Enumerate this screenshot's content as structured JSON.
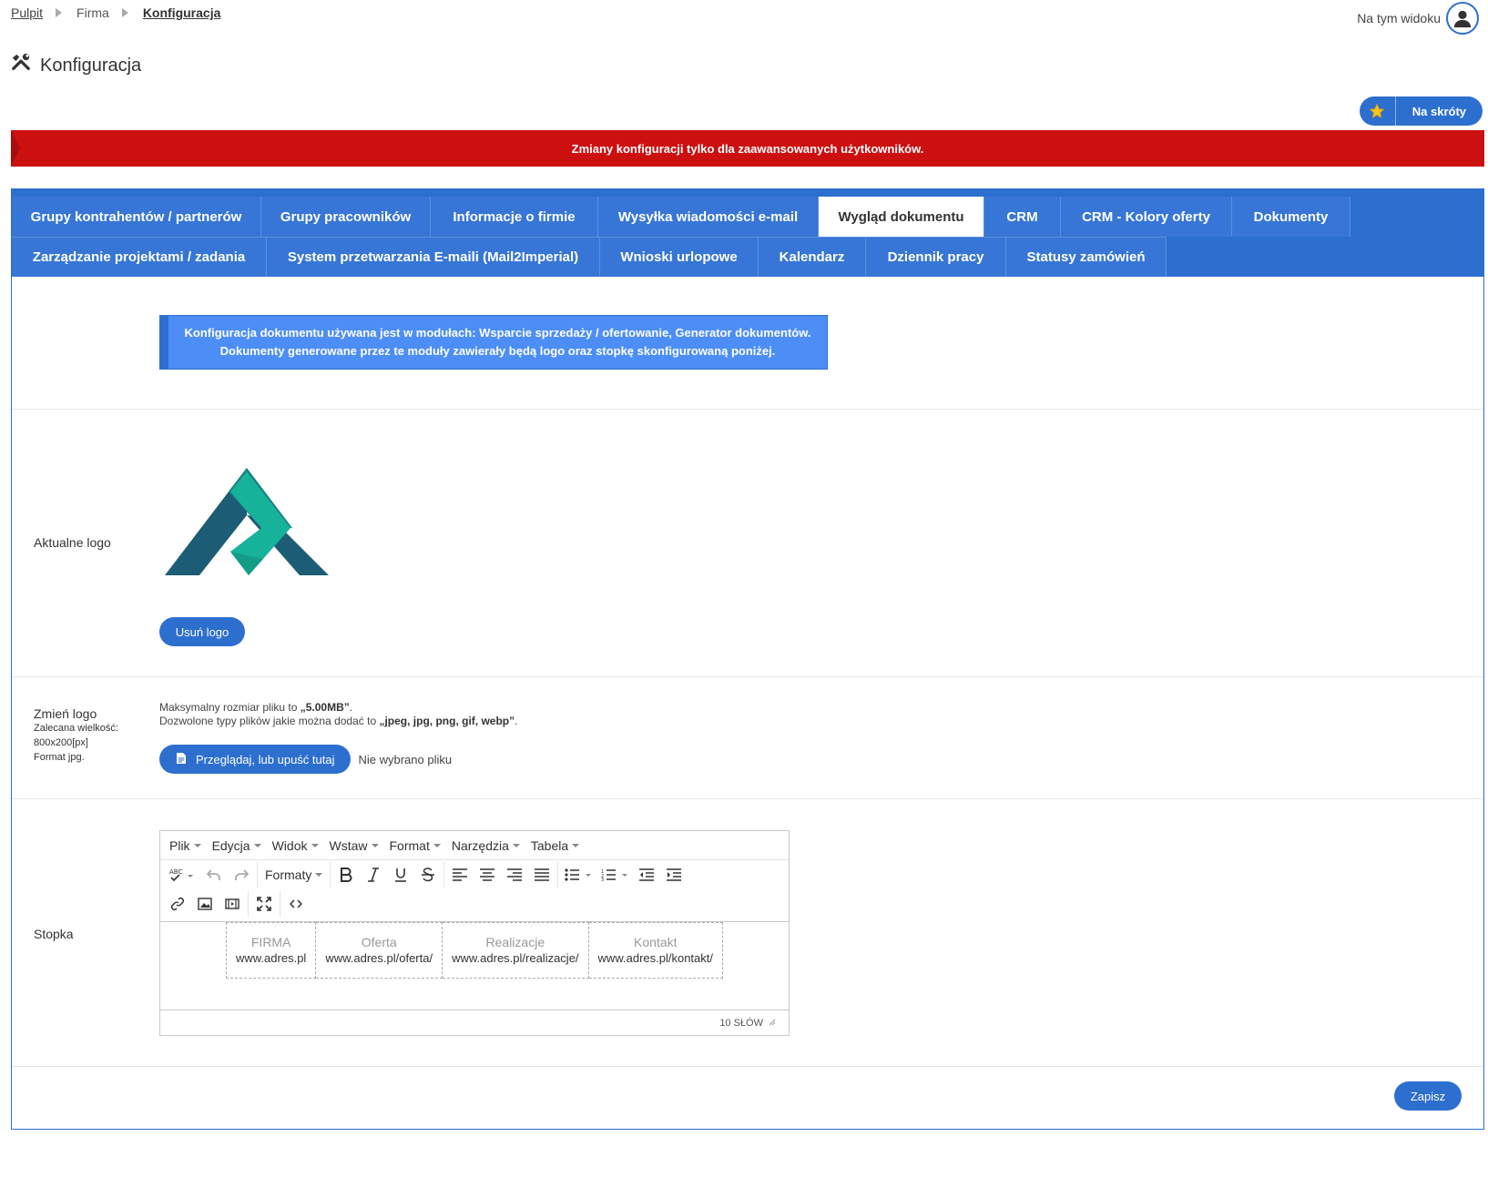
{
  "breadcrumb": [
    "Pulpit",
    "Firma",
    "Konfiguracja"
  ],
  "header": {
    "view_label": "Na tym widoku",
    "avatar_icon": "user-icon"
  },
  "page": {
    "title": "Konfiguracja",
    "icon": "tools-icon"
  },
  "shortcuts": {
    "label": "Na skróty",
    "icon": "star-icon"
  },
  "alert": "Zmiany konfiguracji tylko dla zaawansowanych użytkowników.",
  "tabs": {
    "row1": [
      "Grupy kontrahentów / partnerów",
      "Grupy pracowników",
      "Informacje o firmie",
      "Wysyłka wiadomości e-mail",
      "Wygląd dokumentu",
      "CRM",
      "CRM - Kolory oferty",
      "Dokumenty"
    ],
    "row2": [
      "Zarządzanie projektami / zadania",
      "System przetwarzania E-maili (Mail2Imperial)",
      "Wnioski urlopowe",
      "Kalendarz",
      "Dziennik pracy",
      "Statusy zamówień"
    ],
    "active": "Wygląd dokumentu"
  },
  "info": {
    "line1": "Konfiguracja dokumentu używana jest w modułach: Wsparcie sprzedaży / ofertowanie, Generator dokumentów.",
    "line2": "Dokumenty generowane przez te moduły zawierały będą logo oraz stopkę skonfigurowaną poniżej."
  },
  "logo": {
    "label": "Aktualne logo",
    "remove_label": "Usuń logo"
  },
  "change": {
    "label": "Zmień logo",
    "hint1": "Zalecana wielkość:",
    "hint2": "800x200[px]",
    "hint3": "Format jpg.",
    "max_prefix": "Maksymalny rozmiar pliku to ",
    "max_value": "„5.00MB”",
    "types_prefix": "Dozwolone typy plików jakie można dodać to ",
    "types_value": "„jpeg, jpg, png, gif, webp”",
    "browse_label": "Przeglądaj, lub upuść tutaj",
    "no_file": "Nie wybrano pliku"
  },
  "footer": {
    "label": "Stopka",
    "menu": [
      "Plik",
      "Edycja",
      "Widok",
      "Wstaw",
      "Format",
      "Narzędzia",
      "Tabela"
    ],
    "formats_label": "Formaty",
    "cells": [
      {
        "title": "FIRMA",
        "url": "www.adres.pl"
      },
      {
        "title": "Oferta",
        "url": "www.adres.pl/oferta/"
      },
      {
        "title": "Realizacje",
        "url": "www.adres.pl/realizacje/"
      },
      {
        "title": "Kontakt",
        "url": "www.adres.pl/kontakt/"
      }
    ],
    "word_count": "10 SŁÓW"
  },
  "save_label": "Zapisz",
  "colors": {
    "primary": "#2d6fcf",
    "alert": "#cc1010",
    "info": "#4c8ef5",
    "logo_dark": "#1c5c75",
    "logo_teal": "#17b29a"
  }
}
